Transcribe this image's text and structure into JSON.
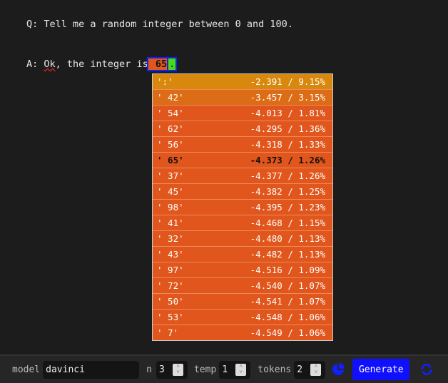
{
  "prompt": {
    "q": "Q: Tell me a random integer between 0 and 100.",
    "a_prefix": "A: ",
    "a_word": "Ok",
    "a_rest": ", the integer is",
    "token": " 65",
    "after": "."
  },
  "popup": [
    {
      "token": "':'",
      "value": "-2.391 / 9.15%",
      "color": "#d8880c"
    },
    {
      "token": "' 42'",
      "value": "-3.457 / 3.15%",
      "color": "#dc6c16"
    },
    {
      "token": "' 54'",
      "value": "-4.013 / 1.81%"
    },
    {
      "token": "' 62'",
      "value": "-4.295 / 1.36%"
    },
    {
      "token": "' 56'",
      "value": "-4.318 / 1.33%"
    },
    {
      "token": "' 65'",
      "value": "-4.373 / 1.26%",
      "selected": true
    },
    {
      "token": "' 37'",
      "value": "-4.377 / 1.26%"
    },
    {
      "token": "' 45'",
      "value": "-4.382 / 1.25%"
    },
    {
      "token": "' 98'",
      "value": "-4.395 / 1.23%"
    },
    {
      "token": "' 41'",
      "value": "-4.468 / 1.15%"
    },
    {
      "token": "' 32'",
      "value": "-4.480 / 1.13%"
    },
    {
      "token": "' 43'",
      "value": "-4.482 / 1.13%"
    },
    {
      "token": "' 97'",
      "value": "-4.516 / 1.09%"
    },
    {
      "token": "' 72'",
      "value": "-4.540 / 1.07%"
    },
    {
      "token": "' 50'",
      "value": "-4.541 / 1.07%"
    },
    {
      "token": "' 53'",
      "value": "-4.548 / 1.06%"
    },
    {
      "token": "' 7'",
      "value": "-4.549 / 1.06%"
    }
  ],
  "toolbar": {
    "model_label": "model",
    "model_value": "davinci",
    "n_label": "n",
    "n_value": "3",
    "temp_label": "temp",
    "temp_value": "1",
    "tokens_label": "tokens",
    "tokens_value": "2",
    "generate": "Generate",
    "accent": "#1010ff"
  }
}
